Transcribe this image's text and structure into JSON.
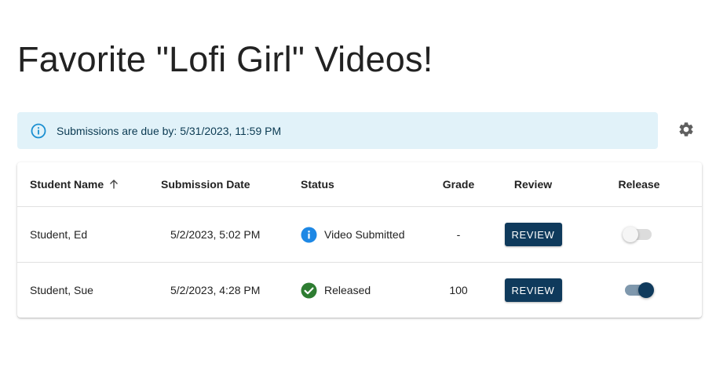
{
  "page": {
    "title": "Favorite \"Lofi Girl\" Videos!"
  },
  "alert": {
    "icon": "info-outline-icon",
    "text": "Submissions are due by: 5/31/2023, 11:59 PM"
  },
  "settings": {
    "icon": "gear-icon"
  },
  "table": {
    "columns": {
      "name": "Student Name",
      "date": "Submission Date",
      "status": "Status",
      "grade": "Grade",
      "review": "Review",
      "release": "Release"
    },
    "sort_icon": "arrow-up-icon",
    "rows": [
      {
        "name": "Student, Ed",
        "date": "5/2/2023, 5:02 PM",
        "status": "Video Submitted",
        "status_icon": "info-filled-icon",
        "grade": "-",
        "review_label": "REVIEW",
        "released": false
      },
      {
        "name": "Student, Sue",
        "date": "5/2/2023, 4:28 PM",
        "status": "Released",
        "status_icon": "check-circle-icon",
        "grade": "100",
        "review_label": "REVIEW",
        "released": true
      }
    ]
  },
  "colors": {
    "primary": "#0f3a5c",
    "alert_bg": "#e1f2f9",
    "info_blue": "#1e88e5",
    "success_green": "#2e7d32"
  }
}
